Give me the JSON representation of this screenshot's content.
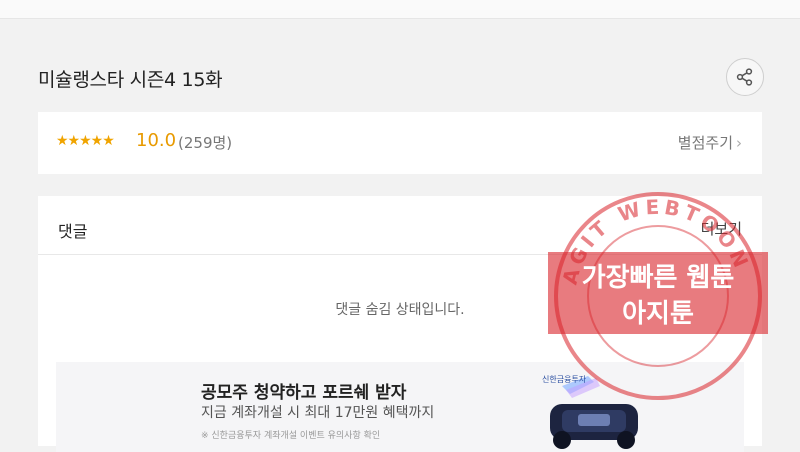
{
  "header": {
    "title": "미슐랭스타 시즌4 15화"
  },
  "rating": {
    "stars": "★★★★★",
    "score": "10.0",
    "count": "(259명)",
    "rate_label": "별점주기",
    "rate_chevron": "›"
  },
  "comments": {
    "title": "댓글",
    "more_label": "더보기",
    "hidden_message": "댓글 숨김 상태입니다."
  },
  "ad": {
    "title": "공모주 청약하고 포르쉐 받자",
    "subtitle": "지금 계좌개설 시 최대 17만원 혜택까지",
    "fine_print": "※ 신한금융투자 계좌개설 이벤트 유의사항 확인",
    "brand": "신한금융투자"
  },
  "watermark": {
    "ring_text": "AGIT WEBTOON",
    "line1": "가장빠른 웹툰",
    "line2": "아지툰",
    "color": "#d8232a"
  },
  "colors": {
    "star": "#f0a400",
    "background": "#f2f2f2"
  }
}
